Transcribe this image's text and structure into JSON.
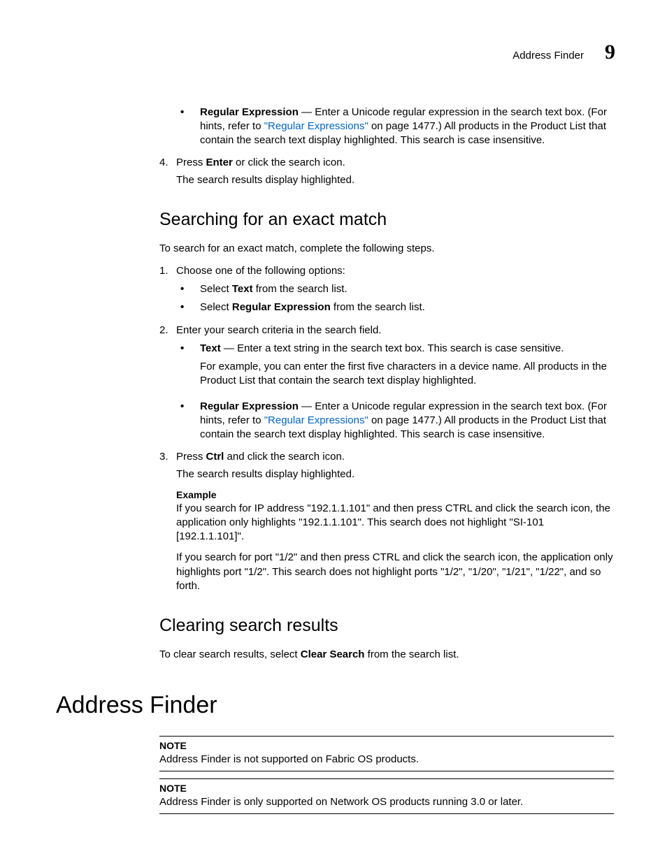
{
  "header": {
    "running_title": "Address Finder",
    "chapter_number": "9"
  },
  "top": {
    "bullet_regex_bold": "Regular Expression",
    "bullet_regex_text1": " — Enter a Unicode regular expression in the search text box. (For hints, refer to ",
    "bullet_regex_link": "\"Regular Expressions\"",
    "bullet_regex_text2": " on page 1477.) All products in the Product List that contain the search text display highlighted. This search is case insensitive.",
    "step4_num": "4.",
    "step4_a": "Press ",
    "step4_bold": "Enter",
    "step4_b": " or click the search icon.",
    "step4_result": "The search results display highlighted."
  },
  "exact": {
    "heading": "Searching for an exact match",
    "intro": "To search for an exact match, complete the following steps.",
    "s1_num": "1.",
    "s1_text": "Choose one of the following options:",
    "s1_opt1_a": "Select ",
    "s1_opt1_bold": "Text",
    "s1_opt1_b": " from the search list.",
    "s1_opt2_a": "Select ",
    "s1_opt2_bold": "Regular Expression",
    "s1_opt2_b": " from the search list.",
    "s2_num": "2.",
    "s2_text": "Enter your search criteria in the search field.",
    "s2_text_bold": "Text",
    "s2_text_body": " — Enter a text string in the search text box. This search is case sensitive.",
    "s2_text_example": "For example, you can enter the first five characters in a device name. All products in the Product List that contain the search text display highlighted.",
    "s2_regex_bold": "Regular Expression",
    "s2_regex_a": " — Enter a Unicode regular expression in the search text box. (For hints, refer to ",
    "s2_regex_link": "\"Regular Expressions\"",
    "s2_regex_b": " on page 1477.) All products in the Product List that contain the search text display highlighted. This search is case insensitive.",
    "s3_num": "3.",
    "s3_a": "Press ",
    "s3_bold": "Ctrl",
    "s3_b": " and click the search icon.",
    "s3_result": "The search results display highlighted.",
    "example_label": "Example",
    "example_p1": "If you search for IP address \"192.1.1.101\" and then press CTRL and click the search icon, the application only highlights \"192.1.1.101\". This search does not highlight \"SI-101 [192.1.1.101]\".",
    "example_p2": "If you search for port \"1/2\" and then press CTRL and click the search icon, the application only highlights port \"1/2\". This search does not highlight ports \"1/2\", \"1/20\", \"1/21\", \"1/22\", and so forth."
  },
  "clear": {
    "heading": "Clearing search results",
    "text_a": "To clear search results, select ",
    "text_bold": "Clear Search",
    "text_b": " from the search list."
  },
  "finder": {
    "heading": "Address Finder",
    "note_label": "NOTE",
    "note1": "Address Finder is not supported on Fabric OS products.",
    "note2": "Address Finder is only supported on Network OS products running 3.0 or later."
  }
}
